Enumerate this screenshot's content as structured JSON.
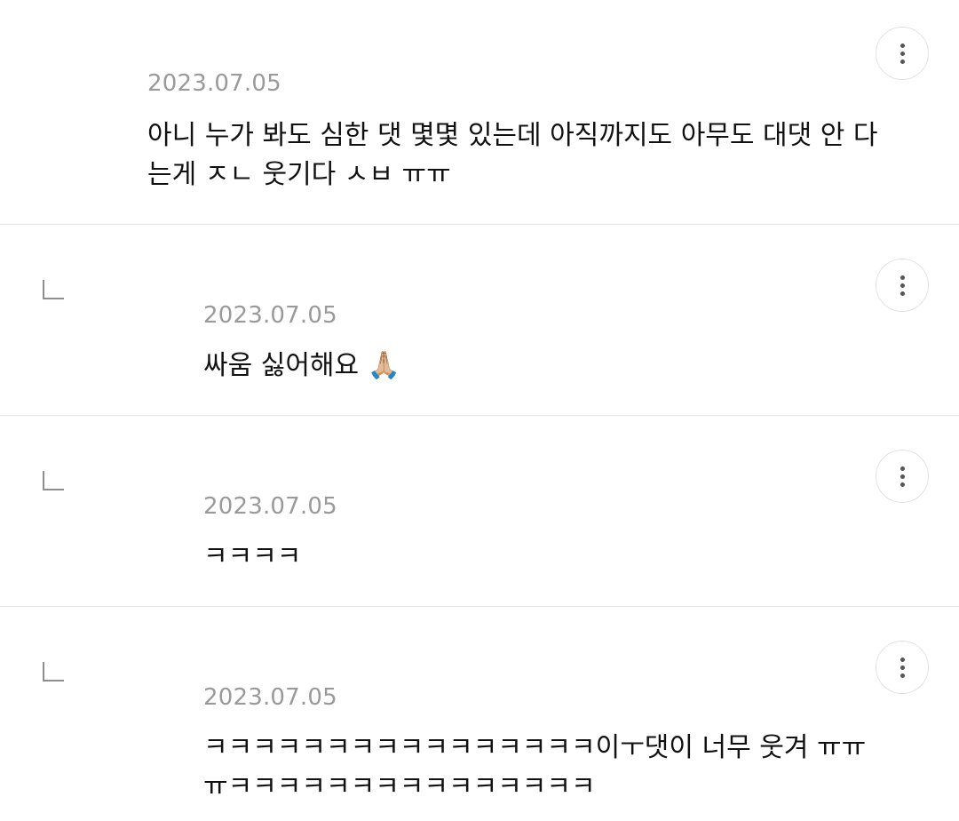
{
  "comments": [
    {
      "date": "2023.07.05",
      "text": "아니 누가 봐도 심한 댓 몇몇 있는데 아직까지도 아무도 대댓 안 다는게 ㅈㄴ 웃기다 ㅅㅂ ㅠㅠ",
      "is_reply": false,
      "more_icon": "more-vertical-icon"
    },
    {
      "date": "2023.07.05",
      "text": "싸움 싫어해요 🙏🏼",
      "is_reply": true,
      "reply_icon": "reply-arrow-icon",
      "more_icon": "more-vertical-icon"
    },
    {
      "date": "2023.07.05",
      "text": "ㅋㅋㅋㅋ",
      "is_reply": true,
      "reply_icon": "reply-arrow-icon",
      "more_icon": "more-vertical-icon"
    },
    {
      "date": "2023.07.05",
      "text": "ㅋㅋㅋㅋㅋㅋㅋㅋㅋㅋㅋㅋㅋㅋㅋㅋ이ㅜ댓이 너무 웃겨 ㅠㅠㅠㅋㅋㅋㅋㅋㅋㅋㅋㅋㅋㅋㅋㅋㅋㅋ",
      "is_reply": true,
      "reply_icon": "reply-arrow-icon",
      "more_icon": "more-vertical-icon"
    }
  ]
}
